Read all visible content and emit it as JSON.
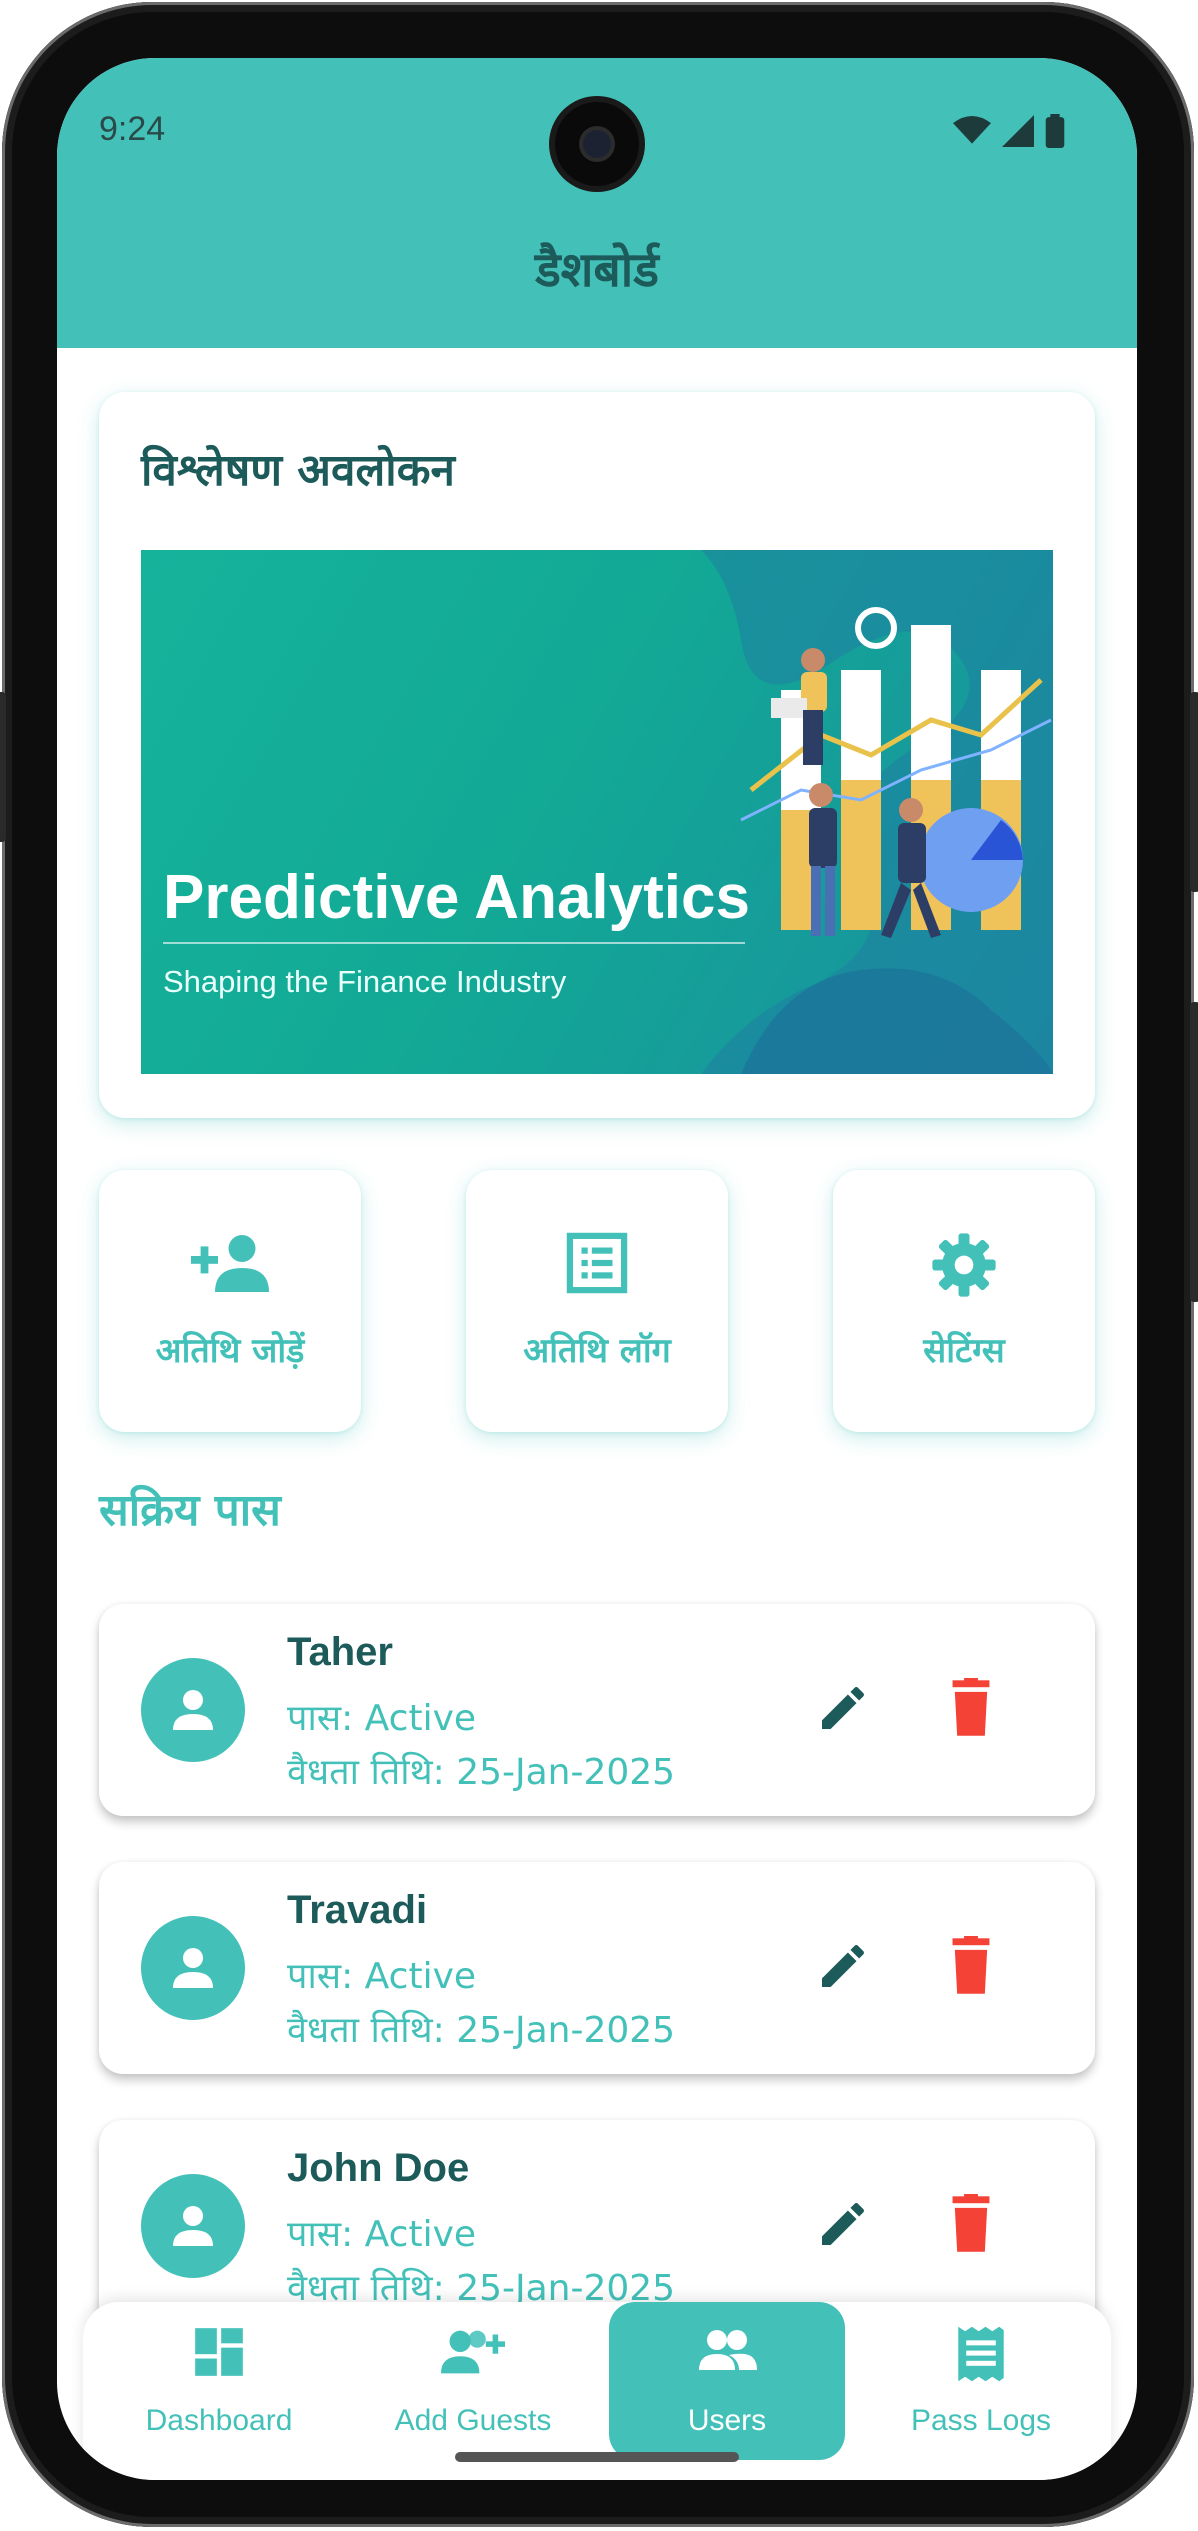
{
  "status_bar": {
    "time": "9:24"
  },
  "header": {
    "title": "डैशबोर्ड"
  },
  "overview": {
    "title": "विश्लेषण अवलोकन",
    "banner_title": "Predictive Analytics",
    "banner_subtitle": "Shaping the Finance Industry"
  },
  "quick_actions": [
    {
      "label": "अतिथि जोड़ें",
      "icon": "add-person-icon"
    },
    {
      "label": "अतिथि लॉग",
      "icon": "list-icon"
    },
    {
      "label": "सेटिंग्स",
      "icon": "gear-icon"
    }
  ],
  "active_passes": {
    "title": "सक्रिय पास",
    "items": [
      {
        "name": "Taher",
        "pass": "पास: Active",
        "valid": "वैधता तिथि: 25-Jan-2025"
      },
      {
        "name": "Travadi",
        "pass": "पास: Active",
        "valid": "वैधता तिथि: 25-Jan-2025"
      },
      {
        "name": "John Doe",
        "pass": "पास: Active",
        "valid": "वैधता तिथि: 25-Jan-2025"
      }
    ]
  },
  "bottom_nav": {
    "items": [
      {
        "label": "Dashboard",
        "icon": "dashboard-icon"
      },
      {
        "label": "Add Guests",
        "icon": "add-group-icon"
      },
      {
        "label": "Users",
        "icon": "group-icon",
        "active": true
      },
      {
        "label": "Pass Logs",
        "icon": "receipt-icon"
      }
    ]
  },
  "colors": {
    "primary": "#43c1b9",
    "dark_text": "#1d5b5a",
    "delete": "#f44336"
  }
}
